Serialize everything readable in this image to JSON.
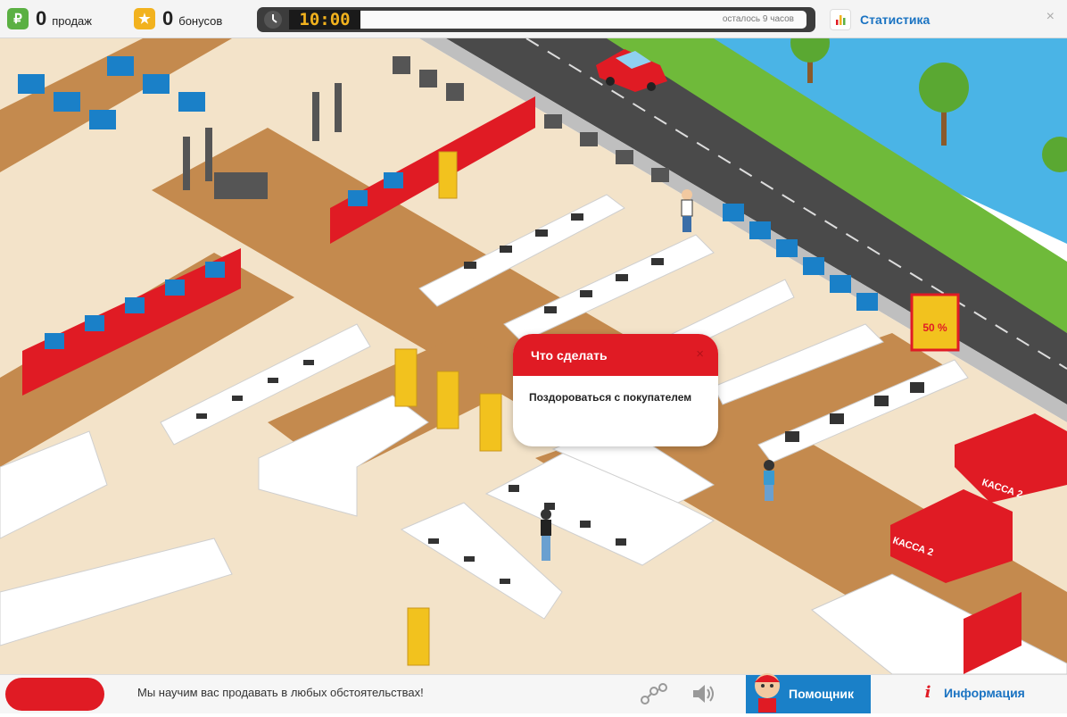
{
  "topbar": {
    "sales_count": "0",
    "sales_label": "продаж",
    "sales_icon": "₽",
    "bonus_count": "0",
    "bonus_label": "бонусов",
    "bonus_icon": "★",
    "timer": "10:00",
    "time_remaining": "осталось 9 часов",
    "stats_label": "Статистика",
    "close": "×"
  },
  "game": {
    "sign_sale": "50 %",
    "cashier_1": "КАССА 2",
    "cashier_2": "КАССА 2",
    "popup": {
      "title": "Что сделать",
      "close": "×",
      "action": "Поздороваться с покупателем"
    }
  },
  "bottombar": {
    "ticker": "Мы научим вас продавать в любых обстоятельствах!",
    "helper_label": "Помощник",
    "info_icon": "i",
    "info_label": "Информация"
  },
  "colors": {
    "brand_red": "#e01b24",
    "link_blue": "#1a73c2",
    "floor_brown": "#c48a4e",
    "floor_cream": "#f3e3c9",
    "road": "#4a4a4a",
    "grass": "#6fba3a",
    "water": "#4ab4e6"
  }
}
